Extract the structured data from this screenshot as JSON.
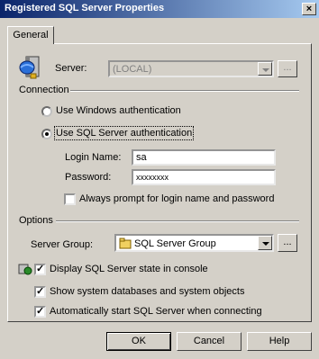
{
  "window": {
    "title": "Registered SQL Server Properties",
    "close_glyph": "×"
  },
  "tabs": [
    {
      "label": "General"
    }
  ],
  "server": {
    "label": "Server:",
    "value": "(LOCAL)",
    "browse_label": "..."
  },
  "connection": {
    "section_label": "Connection",
    "windows_auth_label": "Use Windows authentication",
    "sql_auth_label": "Use SQL Server authentication",
    "selected": "sql",
    "login_label": "Login Name:",
    "login_value": "sa",
    "password_label": "Password:",
    "password_value": "xxxxxxxx",
    "always_prompt_label": "Always prompt for login name and password",
    "always_prompt_checked": false
  },
  "options": {
    "section_label": "Options",
    "server_group_label": "Server Group:",
    "server_group_value": "SQL Server Group",
    "server_group_browse_label": "...",
    "display_state_label": "Display SQL Server state in console",
    "display_state_checked": true,
    "show_system_label": "Show system databases and system objects",
    "show_system_checked": true,
    "auto_start_label": "Automatically start SQL Server when connecting",
    "auto_start_checked": true,
    "check_glyph": "✓"
  },
  "buttons": {
    "ok": "OK",
    "cancel": "Cancel",
    "help": "Help"
  }
}
